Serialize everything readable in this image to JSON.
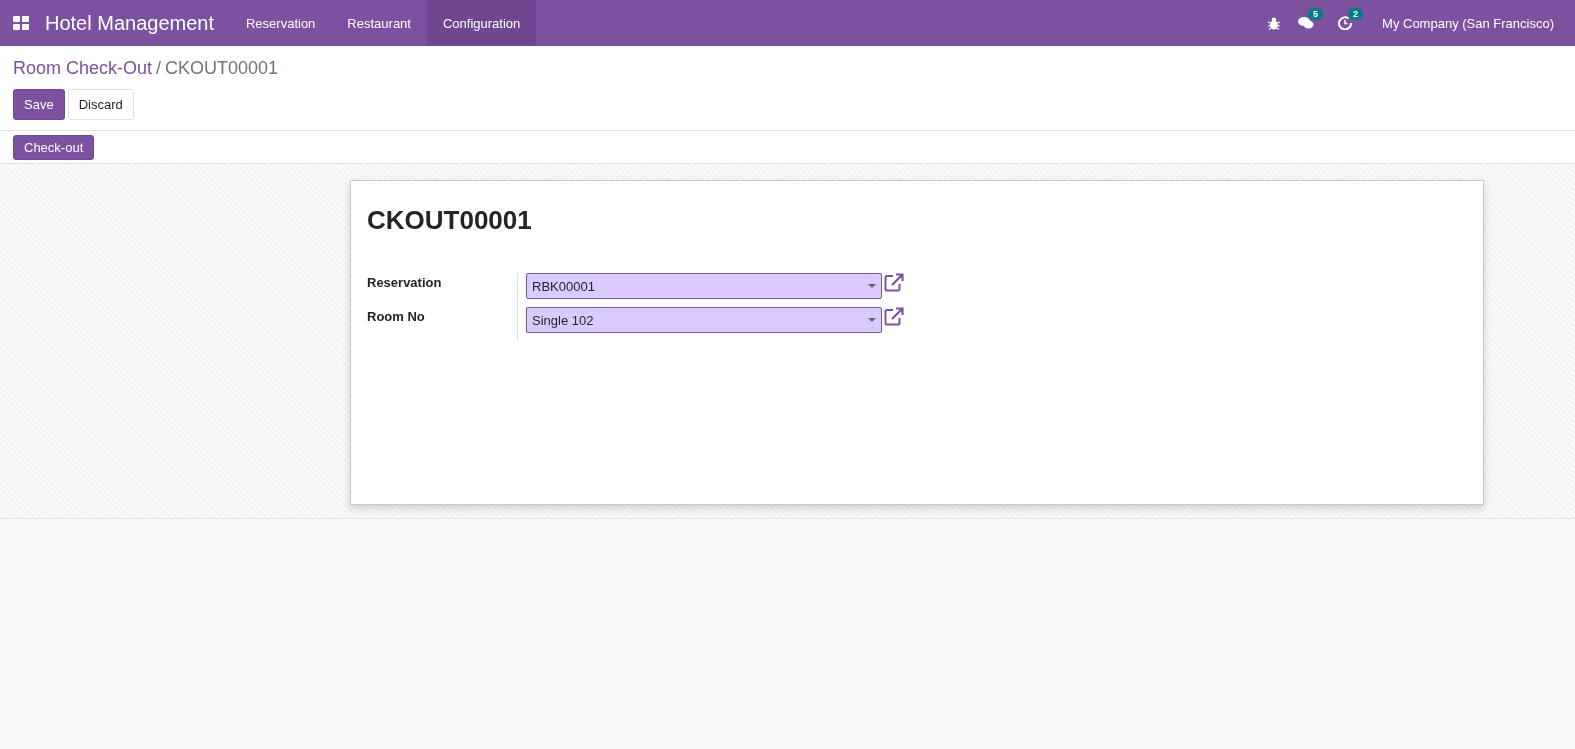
{
  "navbar": {
    "app_name": "Hotel Management",
    "menu": [
      {
        "label": "Reservation",
        "selected": false
      },
      {
        "label": "Restaurant",
        "selected": false
      },
      {
        "label": "Configuration",
        "selected": true
      }
    ],
    "messages_badge": "5",
    "activities_badge": "2",
    "company": "My Company (San Francisco)"
  },
  "breadcrumb": {
    "parent": "Room Check-Out",
    "separator": "/",
    "current": "CKOUT00001"
  },
  "buttons": [
    {
      "label": "Save",
      "kind": "primary"
    },
    {
      "label": "Discard",
      "kind": "secondary"
    }
  ],
  "status_buttons": [
    "Check-out"
  ],
  "form": {
    "title": "CKOUT00001",
    "fields": [
      {
        "label": "Reservation",
        "value": "RBK00001"
      },
      {
        "label": "Room No",
        "value": "Single 102"
      }
    ]
  }
}
